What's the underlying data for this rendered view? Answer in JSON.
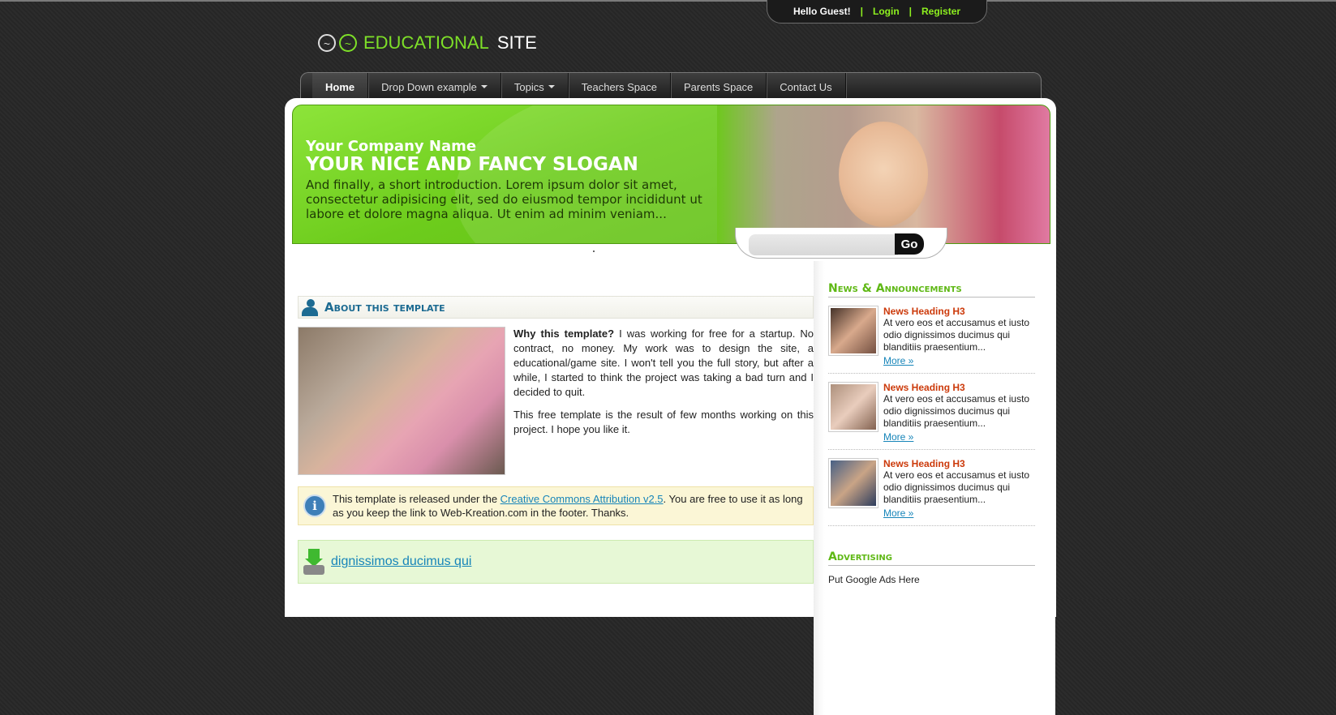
{
  "userbar": {
    "greeting": "Hello Guest!",
    "sep": "|",
    "login": "Login",
    "register": "Register"
  },
  "logo": {
    "part1": "EDUCATIONAL",
    "part2": "SITE",
    "glyph": "~"
  },
  "nav": [
    {
      "label": "Home",
      "active": true
    },
    {
      "label": "Drop Down example",
      "dropdown": true
    },
    {
      "label": "Topics",
      "dropdown": true
    },
    {
      "label": "Teachers Space"
    },
    {
      "label": "Parents Space"
    },
    {
      "label": "Contact Us"
    }
  ],
  "banner": {
    "company": "Your Company Name",
    "slogan": "YOUR NICE AND FANCY SLOGAN",
    "intro": "And finally, a short introduction. Lorem ipsum dolor sit amet, consectetur adipisicing elit, sed do eiusmod tempor incididunt ut labore et dolore magna aliqua. Ut enim ad minim veniam...",
    "search_value": "",
    "go_label": "Go"
  },
  "about": {
    "title": "About this template",
    "bold": "Why this template?",
    "p1": " I was working for free for a startup. No contract, no money. My work was to design the site, a educational/game site. I won't tell you the full story, but after a while, I started to think the project was taking a bad turn and I decided to quit.",
    "p2": "This free template is the result of few months working on this project. I hope you like it."
  },
  "info": {
    "icon": "i",
    "pre": "This template is released under the ",
    "link": "Creative Commons Attribution v2.5",
    "post": ". You are free to use it as long as you keep the link to Web-Kreation.com in the footer. Thanks."
  },
  "download": {
    "link": "dignissimos ducimus qui"
  },
  "sidebar": {
    "news_title": "News & Announcements",
    "news": [
      {
        "heading": "News Heading H3",
        "text": "At vero eos et accusamus et iusto odio dignissimos ducimus qui blanditiis praesentium...",
        "more": "More »"
      },
      {
        "heading": "News Heading H3",
        "text": "At vero eos et accusamus et iusto odio dignissimos ducimus qui blanditiis praesentium...",
        "more": "More »"
      },
      {
        "heading": "News Heading H3",
        "text": "At vero eos et accusamus et iusto odio dignissimos ducimus qui blanditiis praesentium...",
        "more": "More »"
      }
    ],
    "adv_title": "Advertising",
    "adv_text": "Put Google Ads Here"
  },
  "colors": {
    "accent_green": "#7ee028",
    "link_blue": "#1785b9",
    "heading_blue": "#1d6b92",
    "news_red": "#cc3a0b"
  }
}
